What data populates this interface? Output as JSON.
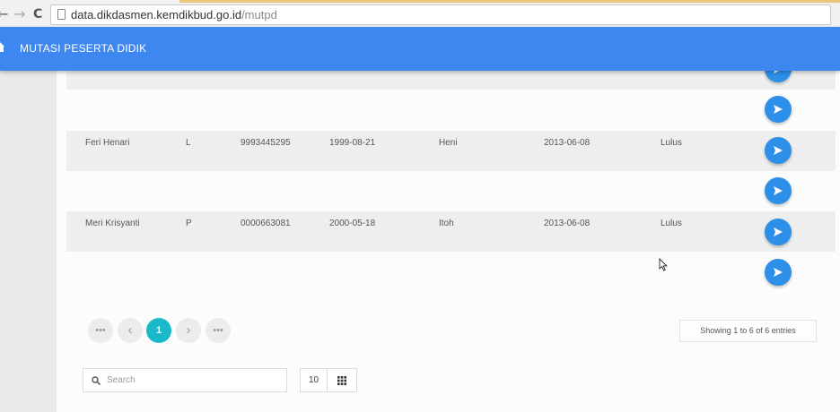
{
  "browser": {
    "url_domain": "data.dikdasmen.kemdikbud.go.id",
    "url_path": "/mutpd",
    "back_glyph": "←",
    "forward_glyph": "→",
    "reload_glyph": "C"
  },
  "header": {
    "title": "MUTASI PESERTA DIDIK",
    "home_icon": "home-icon",
    "color": "#3f87f0"
  },
  "table": {
    "rows": [
      {
        "nama": "Feri Henari",
        "jk": "L",
        "nisn": "9993445295",
        "tgl_lahir": "1999-08-21",
        "ibu": "Heni",
        "tgl_lulus": "2013-06-08",
        "status": "Lulus"
      },
      {
        "nama": "Meri Krisyanti",
        "jk": "P",
        "nisn": "0000663081",
        "tgl_lahir": "2000-05-18",
        "ibu": "Itoh",
        "tgl_lulus": "2013-06-08",
        "status": "Lulus"
      }
    ],
    "action_icon": "send-icon",
    "action_color": "#2d8fe8"
  },
  "pagination": {
    "first": "•••",
    "prev": "‹",
    "current": "1",
    "next": "›",
    "last": "•••",
    "active_color": "#19b9c9"
  },
  "entries_info": "Showing 1 to 6 of 6 entries",
  "search": {
    "placeholder": "Search",
    "value": ""
  },
  "page_size": "10",
  "grid_icon": "grid-icon"
}
